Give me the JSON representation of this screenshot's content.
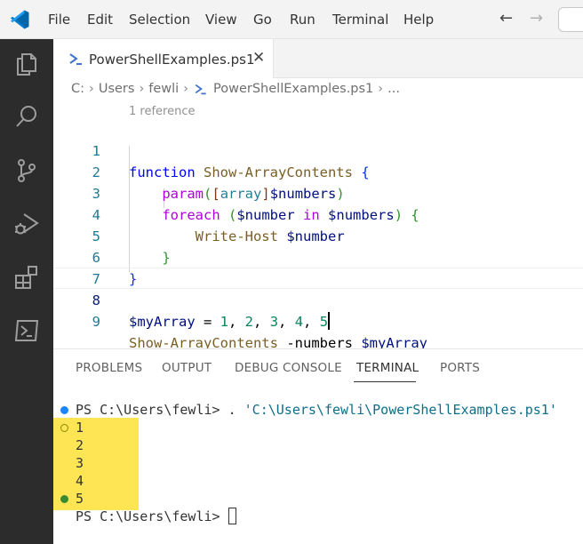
{
  "titlebar": {
    "menu": [
      "File",
      "Edit",
      "Selection",
      "View",
      "Go",
      "Run",
      "Terminal",
      "Help"
    ],
    "back_arrow": "←",
    "forward_arrow": "→"
  },
  "activity_bar": {
    "icons": [
      "explorer-icon",
      "search-icon",
      "source-control-icon",
      "run-debug-icon",
      "extensions-icon",
      "powershell-icon"
    ]
  },
  "tab": {
    "label": "PowerShellExamples.ps1",
    "close": "✕"
  },
  "breadcrumb": {
    "items": [
      "C:",
      "Users",
      "fewli",
      "PowerShellExamples.ps1",
      "..."
    ],
    "separator": "›"
  },
  "editor": {
    "codelens": "1 reference",
    "line_numbers": [
      "1",
      "2",
      "3",
      "4",
      "5",
      "6",
      "7",
      "8",
      "9"
    ],
    "lines": {
      "l1": [
        "function",
        " ",
        "Show-ArrayContents",
        " ",
        "{"
      ],
      "l2": [
        "param",
        "(",
        "[",
        "array",
        "]",
        "$numbers",
        ")"
      ],
      "l3": [
        "foreach",
        " ",
        "(",
        "$number",
        " ",
        "in",
        " ",
        "$numbers",
        ")",
        " ",
        "{"
      ],
      "l4": [
        "Write-Host",
        " ",
        "$number"
      ],
      "l5": [
        "}"
      ],
      "l6": [
        "}"
      ],
      "l8": [
        "$myArray",
        " = ",
        "1",
        ", ",
        "2",
        ", ",
        "3",
        ", ",
        "4",
        ", ",
        "5"
      ],
      "l9": [
        "Show-ArrayContents",
        " ",
        "-numbers",
        " ",
        "$myArray"
      ]
    }
  },
  "panel": {
    "tabs": [
      "PROBLEMS",
      "OUTPUT",
      "DEBUG CONSOLE",
      "TERMINAL",
      "PORTS"
    ],
    "active_tab": "TERMINAL",
    "terminal": {
      "prompt1": "PS C:\\Users\\fewli>",
      "command1_dot": " . ",
      "command1_path": "'C:\\Users\\fewli\\PowerShellExamples.ps1'",
      "output": [
        "1",
        "2",
        "3",
        "4",
        "5"
      ],
      "prompt2": "PS C:\\Users\\fewli>"
    }
  },
  "colors": {
    "activity_bar": "#2c2c2c",
    "keyword": "#0000ff",
    "function_name": "#795e26",
    "variable": "#001080",
    "number": "#098658",
    "highlight": "#fde553",
    "vscode_blue": "#0078d4"
  }
}
